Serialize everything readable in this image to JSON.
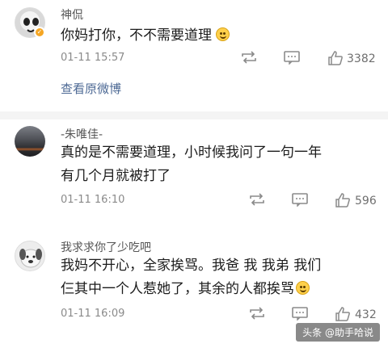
{
  "comments": [
    {
      "username": "神侃",
      "text": "你妈打你，不不需要道理",
      "time": "01-11 15:57",
      "likes": "3382",
      "view_original": "查看原微博"
    },
    {
      "username": "-朱唯佳-",
      "text_line1": "真的是不需要道理，小时候我问了一句一年",
      "text_line2": "有几个月就被打了",
      "time": "01-11 16:10",
      "likes": "596"
    },
    {
      "username": "我求求你了少吃吧",
      "text_line1": "我妈不开心，全家挨骂。我爸 我 我弟 我们",
      "text_line2": "仨其中一个人惹她了，其余的人都挨骂",
      "time": "01-11 16:09",
      "likes": "432"
    }
  ],
  "watermark": "头条 @助手哈说",
  "icons": {
    "repost": "repost-icon",
    "comment": "comment-icon",
    "like": "thumbs-up-icon",
    "emoji": "smile-emoji-icon"
  }
}
